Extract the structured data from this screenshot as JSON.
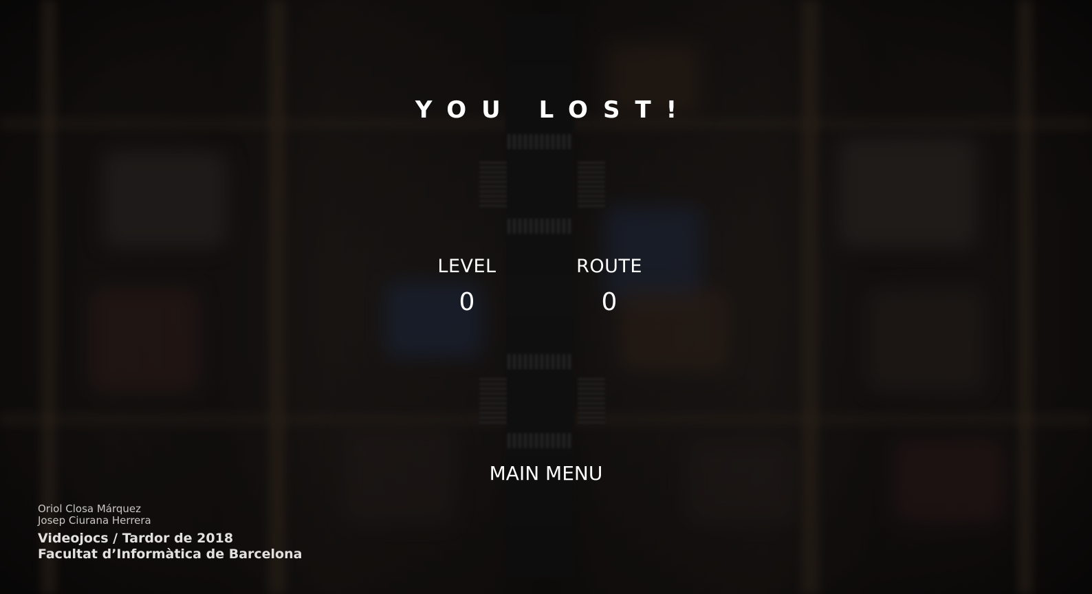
{
  "screen": {
    "title": "YOU LOST!"
  },
  "stats": {
    "level_label": "LEVEL",
    "level_value": "0",
    "route_label": "ROUTE",
    "route_value": "0"
  },
  "menu": {
    "main_menu_label": "MAIN MENU"
  },
  "credits": {
    "author_1": "Oriol Closa Márquez",
    "author_2": "Josep Ciurana Herrera",
    "course": "Videojocs / Tardor de 2018",
    "faculty": "Facultat d’Informàtica de Barcelona"
  },
  "colors": {
    "text": "#ffffff",
    "background": "#151312"
  }
}
